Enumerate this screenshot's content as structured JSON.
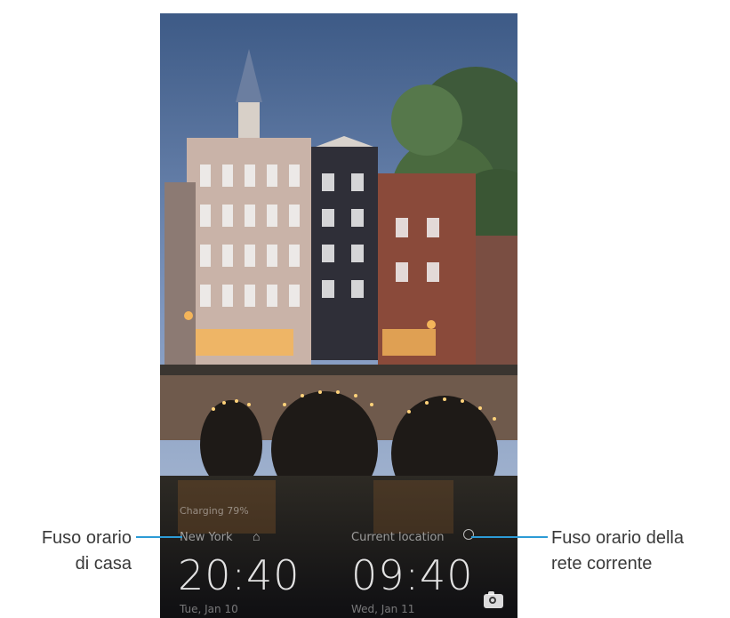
{
  "lockscreen": {
    "charging_status": "Charging 79%",
    "home_clock": {
      "city": "New York",
      "time": "20:40",
      "date": "Tue, Jan 10"
    },
    "current_clock": {
      "city": "Current location",
      "time": "09:40",
      "date": "Wed, Jan 11"
    },
    "icons": {
      "home": "home-icon",
      "location": "location-icon",
      "camera": "camera-icon"
    }
  },
  "callouts": {
    "home_timezone_line1": "Fuso orario",
    "home_timezone_line2": "di casa",
    "network_timezone_line1": "Fuso orario della",
    "network_timezone_line2": "rete corrente"
  },
  "colors": {
    "leader_line": "#2c9bd6",
    "callout_text": "#3a3a3a"
  }
}
